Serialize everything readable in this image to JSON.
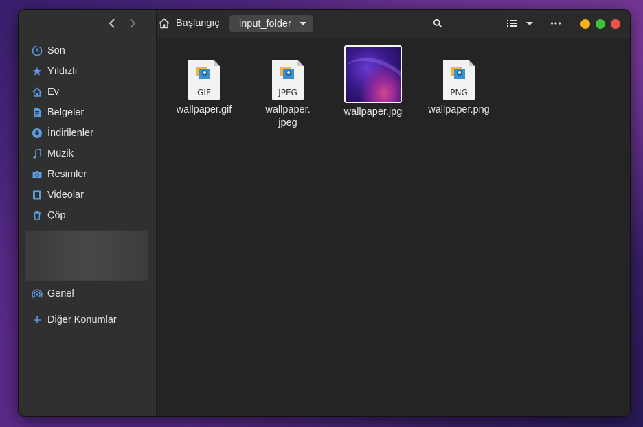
{
  "window": {
    "title": "input_folder"
  },
  "sidebar": {
    "items": [
      {
        "label": "Son",
        "icon": "clock-icon"
      },
      {
        "label": "Yıldızlı",
        "icon": "star-icon"
      },
      {
        "label": "Ev",
        "icon": "home-icon"
      },
      {
        "label": "Belgeler",
        "icon": "document-icon"
      },
      {
        "label": "İndirilenler",
        "icon": "download-icon"
      },
      {
        "label": "Müzik",
        "icon": "music-icon"
      },
      {
        "label": "Resimler",
        "icon": "camera-icon"
      },
      {
        "label": "Videolar",
        "icon": "film-icon"
      },
      {
        "label": "Çöp",
        "icon": "trash-icon"
      }
    ],
    "network": {
      "label": "Genel",
      "icon": "network-icon"
    },
    "other": {
      "label": "Diğer Konumlar",
      "icon": "plus-icon"
    }
  },
  "header": {
    "home_label": "Başlangıç",
    "folder_label": "input_folder"
  },
  "files": [
    {
      "name": "wallpaper.gif",
      "ext": "GIF",
      "kind": "doc"
    },
    {
      "name": "wallpaper.\njpeg",
      "name_line1": "wallpaper.",
      "name_line2": "jpeg",
      "ext": "JPEG",
      "kind": "doc"
    },
    {
      "name": "wallpaper.jpg",
      "ext": "",
      "kind": "image"
    },
    {
      "name": "wallpaper.png",
      "ext": "PNG",
      "kind": "doc"
    }
  ],
  "colors": {
    "accent": "#5b9bde",
    "min": "#f4b216",
    "max": "#3cc13b",
    "close": "#f2504b"
  }
}
